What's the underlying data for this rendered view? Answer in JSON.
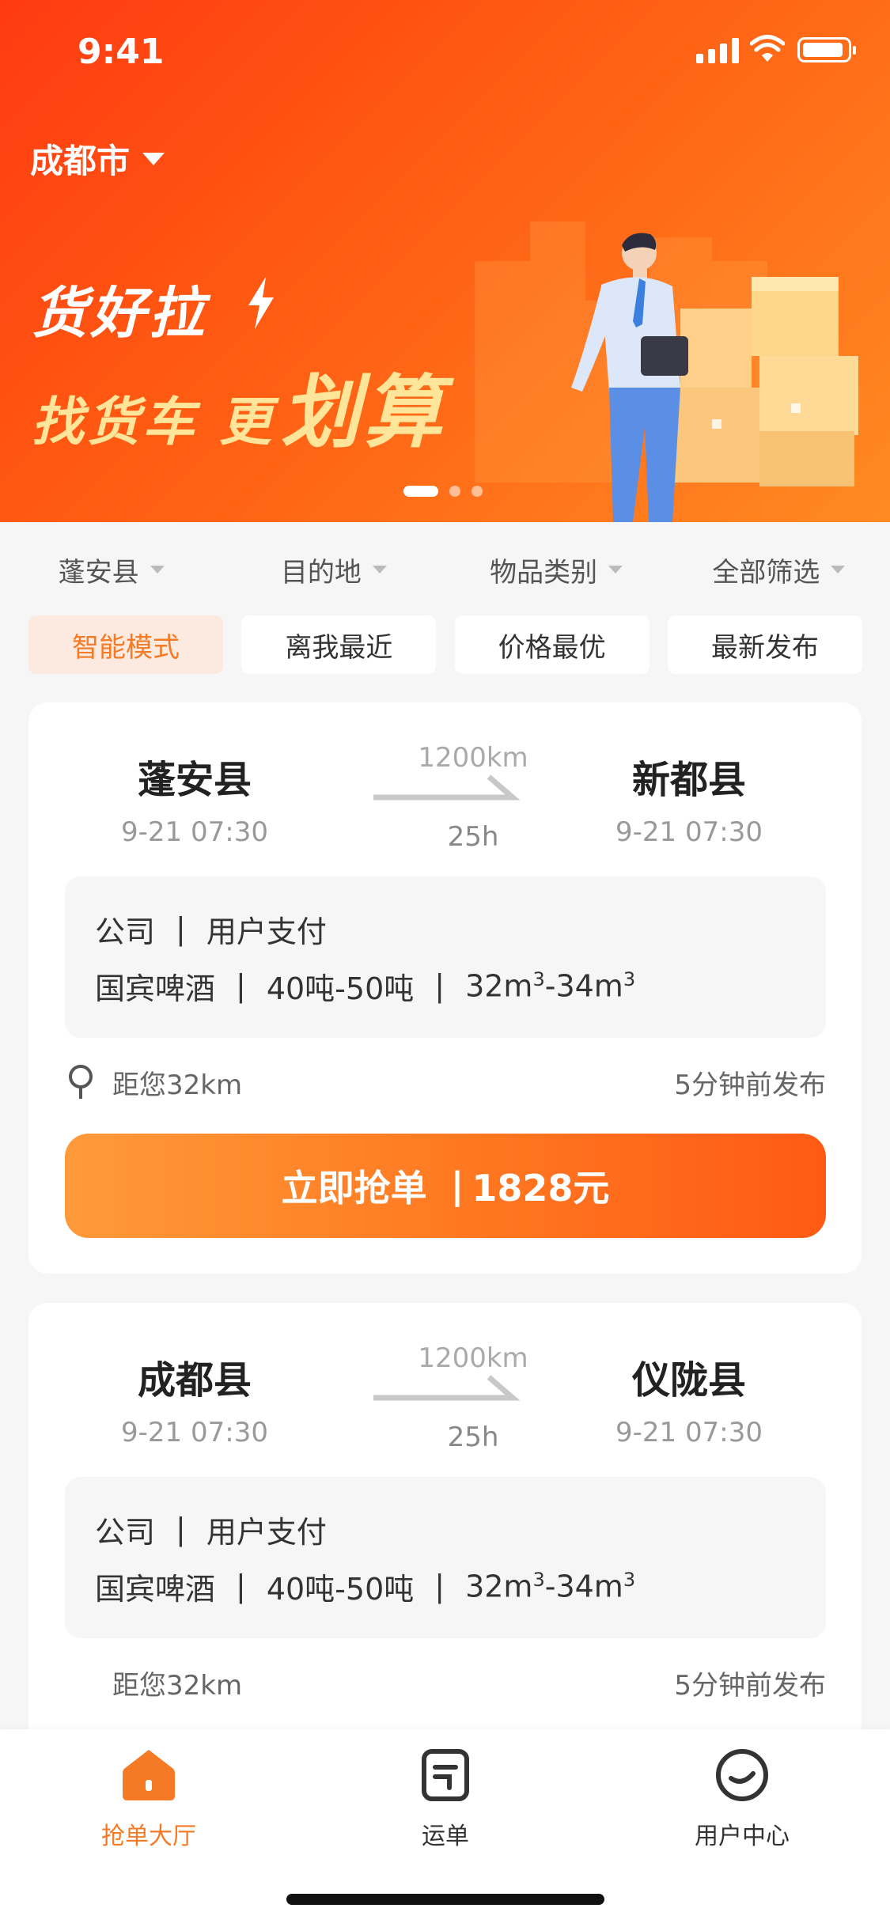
{
  "status": {
    "time": "9:41"
  },
  "header": {
    "city": "成都市"
  },
  "banner": {
    "line1": "货好拉",
    "line2_a": "找货车 更",
    "line2_b": "划算",
    "slides": 3,
    "active_slide": 1
  },
  "filters": [
    "蓬安县",
    "目的地",
    "物品类别",
    "全部筛选"
  ],
  "sorts": {
    "items": [
      "智能模式",
      "离我最近",
      "价格最优",
      "最新发布"
    ],
    "active": 0
  },
  "orders": [
    {
      "from": {
        "name": "蓬安县",
        "time": "9-21 07:30"
      },
      "to": {
        "name": "新都县",
        "time": "9-21 07:30"
      },
      "distance": "1200km",
      "duration": "25h",
      "company": "公司",
      "payment": "用户支付",
      "goods": "国宾啤酒",
      "weight": "40吨-50吨",
      "volume_from": "32m",
      "volume_to": "34m",
      "volume_exp": "3",
      "nearby": "距您32km",
      "posted": "5分钟前发布",
      "action": "立即抢单",
      "price": "1828元"
    },
    {
      "from": {
        "name": "成都县",
        "time": "9-21 07:30"
      },
      "to": {
        "name": "仪陇县",
        "time": "9-21 07:30"
      },
      "distance": "1200km",
      "duration": "25h",
      "company": "公司",
      "payment": "用户支付",
      "goods": "国宾啤酒",
      "weight": "40吨-50吨",
      "volume_from": "32m",
      "volume_to": "34m",
      "volume_exp": "3",
      "nearby": "距您32km",
      "posted": "5分钟前发布"
    }
  ],
  "tabs": [
    {
      "label": "抢单大厅",
      "icon": "home-icon",
      "active": true
    },
    {
      "label": "运单",
      "icon": "document-icon",
      "active": false
    },
    {
      "label": "用户中心",
      "icon": "user-smile-icon",
      "active": false
    }
  ],
  "colors": {
    "accent": "#F57A25",
    "banner_start": "#FF3A12",
    "banner_end": "#FF8A22"
  }
}
